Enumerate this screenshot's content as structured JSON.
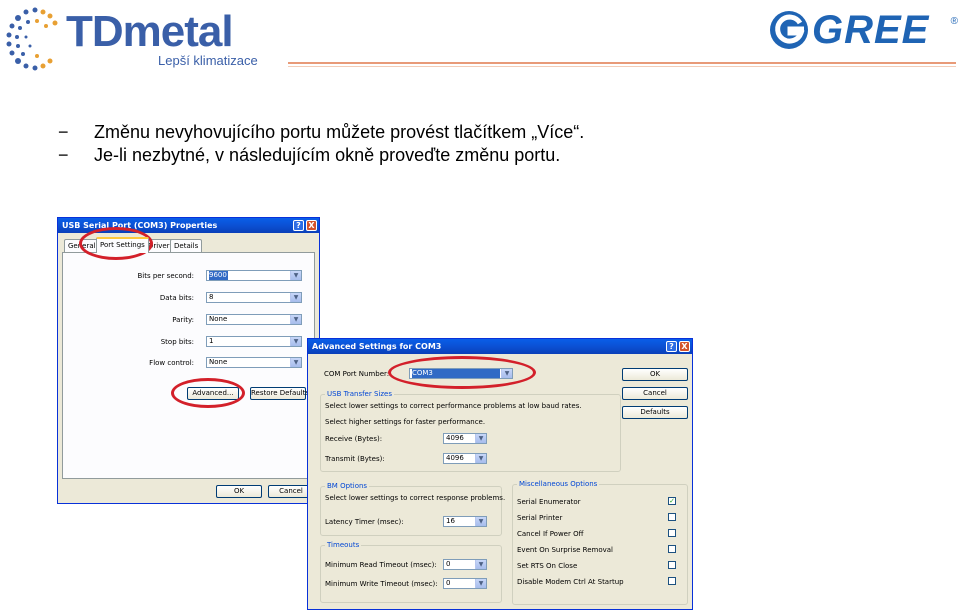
{
  "header": {
    "left_logo": {
      "brand": "TDmetal",
      "tagline": "Lepší klimatizace"
    },
    "right_logo": {
      "brand": "GREE",
      "registered": "®"
    }
  },
  "bullets": [
    {
      "dash": "−",
      "text": "Změnu nevyhovujícího portu můžete provést tlačítkem „Více“."
    },
    {
      "dash": "−",
      "text": "Je-li nezbytné, v následujícím okně proveďte změnu portu."
    }
  ],
  "properties_window": {
    "title": "USB Serial Port (COM3) Properties",
    "help_btn": "?",
    "close_btn": "X",
    "tabs": [
      "General",
      "Port Settings",
      "Driver",
      "Details"
    ],
    "fields": [
      {
        "label": "Bits per second:",
        "value": "9600"
      },
      {
        "label": "Data bits:",
        "value": "8"
      },
      {
        "label": "Parity:",
        "value": "None"
      },
      {
        "label": "Stop bits:",
        "value": "1"
      },
      {
        "label": "Flow control:",
        "value": "None"
      }
    ],
    "advanced_button": "Advanced...",
    "restore_button": "Restore Defaults",
    "ok_button": "OK",
    "cancel_button": "Cancel"
  },
  "advanced_window": {
    "title": "Advanced Settings for COM3",
    "help_btn": "?",
    "close_btn": "X",
    "com_port_label": "COM Port Number:",
    "com_port_value": "COM3",
    "buttons": {
      "ok": "OK",
      "cancel": "Cancel",
      "defaults": "Defaults"
    },
    "usb": {
      "title": "USB Transfer Sizes",
      "text1": "Select lower settings to correct performance problems at low baud rates.",
      "text2": "Select higher settings for faster performance.",
      "receive_label": "Receive (Bytes):",
      "receive_value": "4096",
      "transmit_label": "Transmit (Bytes):",
      "transmit_value": "4096"
    },
    "bm": {
      "title": "BM Options",
      "text": "Select lower settings to correct response problems.",
      "latency_label": "Latency Timer (msec):",
      "latency_value": "16"
    },
    "timeouts": {
      "title": "Timeouts",
      "read_label": "Minimum Read Timeout (msec):",
      "read_value": "0",
      "write_label": "Minimum Write Timeout (msec):",
      "write_value": "0"
    },
    "misc": {
      "title": "Miscellaneous Options",
      "options": [
        {
          "label": "Serial Enumerator",
          "checked": true
        },
        {
          "label": "Serial Printer",
          "checked": false
        },
        {
          "label": "Cancel If Power Off",
          "checked": false
        },
        {
          "label": "Event On Surprise Removal",
          "checked": false
        },
        {
          "label": "Set RTS On Close",
          "checked": false
        },
        {
          "label": "Disable Modem Ctrl At Startup",
          "checked": false
        }
      ]
    }
  },
  "colors": {
    "highlight_ring": "#d3202a",
    "brand_blue": "#3a5fa8",
    "xp_title": "#0b4fd1",
    "selection": "#316ac5"
  }
}
